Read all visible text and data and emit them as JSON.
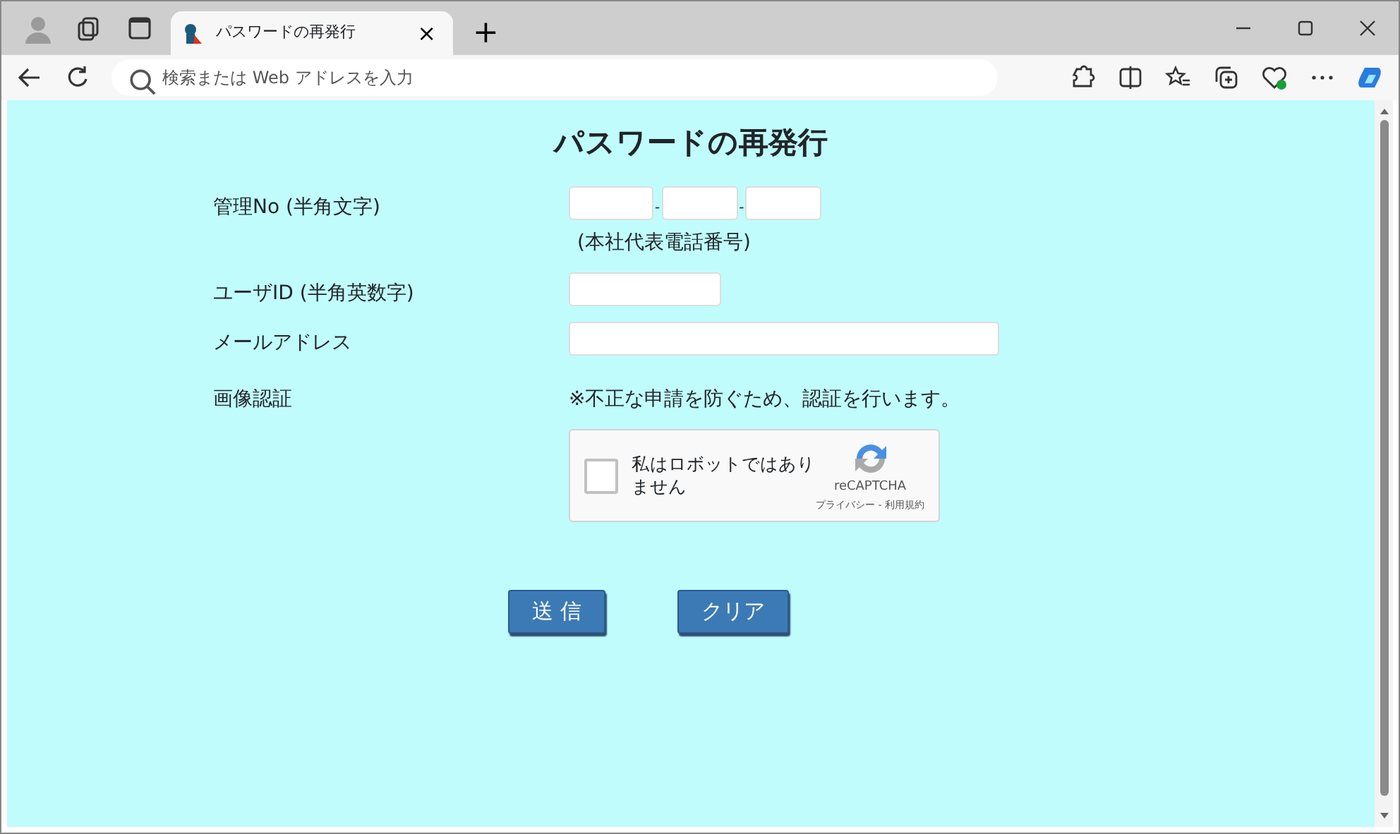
{
  "browser": {
    "tab": {
      "title": "パスワードの再発行",
      "close": "×",
      "selected": true
    },
    "new_tab": "+",
    "address_bar": {
      "placeholder": "検索または Web アドレスを入力"
    }
  },
  "form": {
    "title": "パスワードの再発行",
    "rows": [
      {
        "kind": "phone",
        "label": "管理No (半角文字)",
        "separators": [
          "-",
          "-"
        ],
        "note": "(本社代表電話番号)"
      },
      {
        "kind": "short",
        "label": "ユーザID (半角英数字)"
      },
      {
        "kind": "wide",
        "label": "メールアドレス"
      },
      {
        "kind": "captcha",
        "label": "画像認証",
        "note": "※不正な申請を防ぐため、認証を行います。"
      }
    ],
    "captcha": {
      "checked": false,
      "label": "私はロボットではありません",
      "brand": "reCAPTCHA",
      "links": "プライバシー - 利用規約"
    },
    "buttons": [
      "送 信",
      "クリア"
    ]
  }
}
